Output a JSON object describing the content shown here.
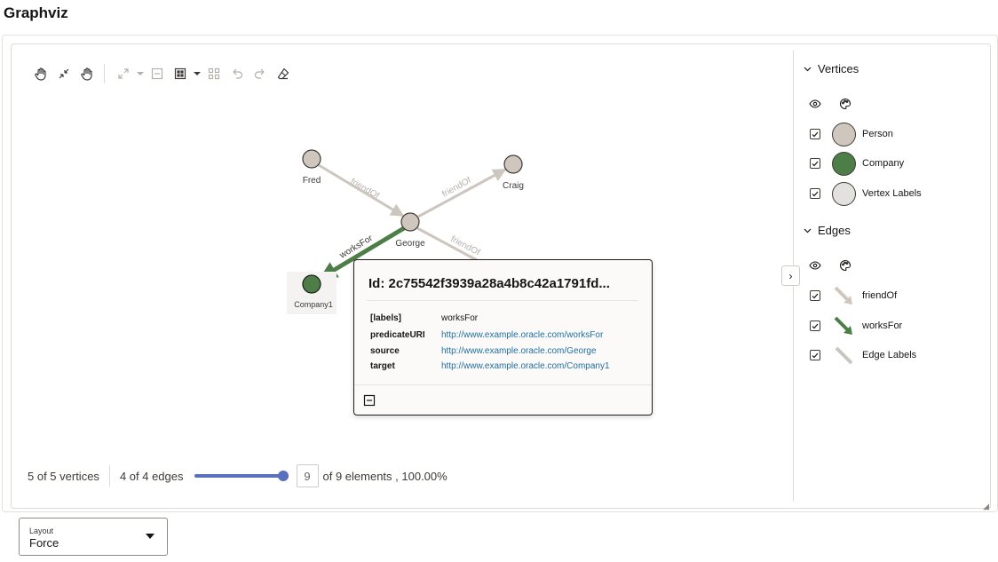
{
  "page": {
    "title": "Graphviz"
  },
  "graph": {
    "vertices": [
      {
        "label": "Fred"
      },
      {
        "label": "Craig"
      },
      {
        "label": "George"
      },
      {
        "label": "Company1"
      }
    ],
    "edges": [
      {
        "label": "friendOf"
      },
      {
        "label": "friendOf"
      },
      {
        "label": "worksFor"
      },
      {
        "label": "friendOf"
      }
    ]
  },
  "popup": {
    "title": "Id: 2c75542f3939a28a4b8c42a1791fd...",
    "properties": [
      {
        "key": "[labels]",
        "value": "worksFor"
      },
      {
        "key": "predicateURI",
        "value": "http://www.example.oracle.com/worksFor"
      },
      {
        "key": "source",
        "value": "http://www.example.oracle.com/George"
      },
      {
        "key": "target",
        "value": "http://www.example.oracle.com/Company1"
      }
    ]
  },
  "stats": {
    "vertices": "5 of 5 vertices",
    "edges": "4 of 4 edges",
    "slider_fraction": 1.0,
    "count": "9",
    "count_suffix": "of 9 elements , 100.00%"
  },
  "legend": {
    "vertices_heading": "Vertices",
    "vertex_items": [
      {
        "label": "Person",
        "color": "#cfc7be"
      },
      {
        "label": "Company",
        "color": "#4e7e48"
      },
      {
        "label": "Vertex Labels",
        "color": "#e3e1de"
      }
    ],
    "edges_heading": "Edges",
    "edge_items": [
      {
        "label": "friendOf",
        "color": "#cfc7be"
      },
      {
        "label": "worksFor",
        "color": "#4e7e48"
      },
      {
        "label": "Edge Labels",
        "color": "#c9c5c0"
      }
    ]
  },
  "layout_select": {
    "label": "Layout",
    "value": "Force"
  },
  "colors": {
    "accent": "#5b6fbf",
    "person": "#cfc7be",
    "company": "#4e7e48",
    "link": "#1f6fa1"
  }
}
